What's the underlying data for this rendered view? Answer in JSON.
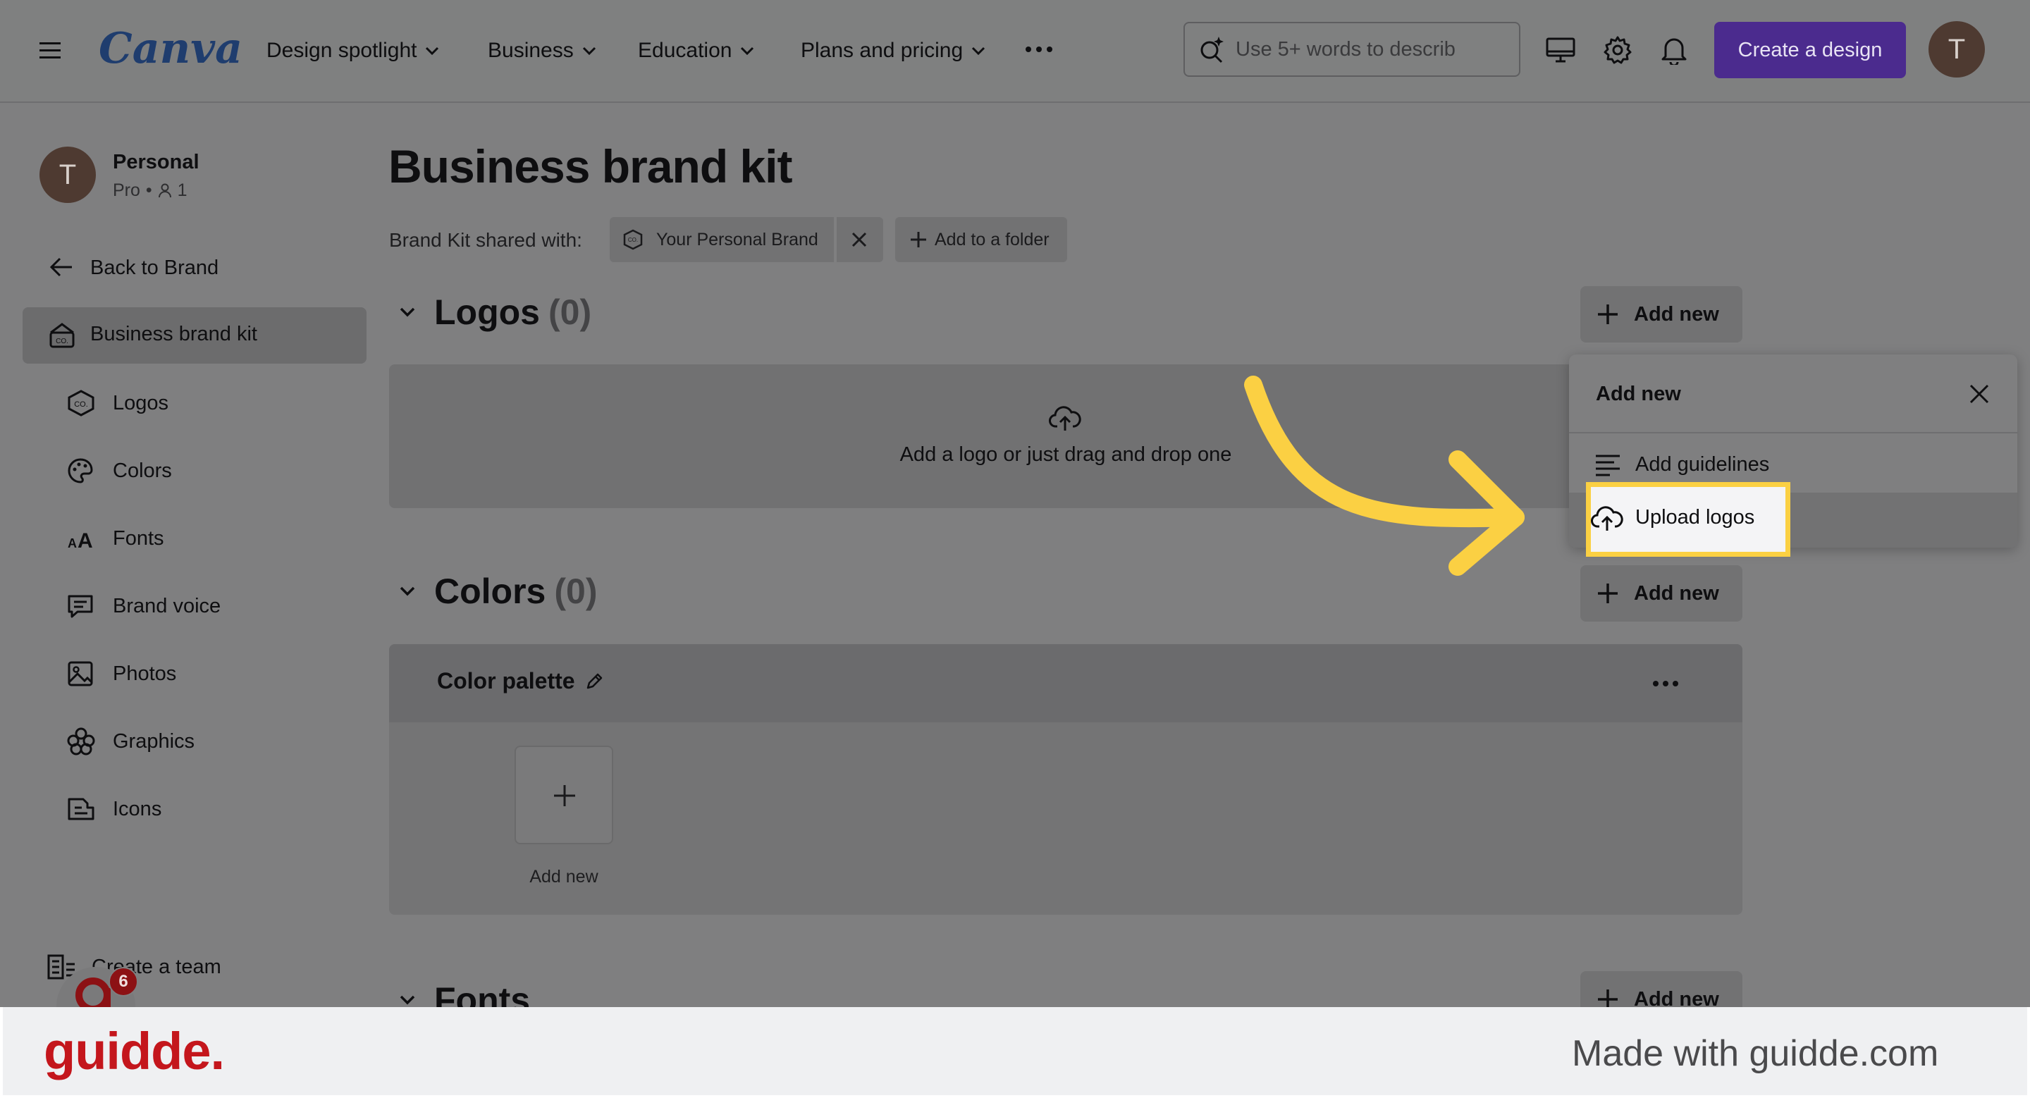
{
  "header": {
    "logo": "Canva",
    "nav": [
      {
        "label": "Design spotlight"
      },
      {
        "label": "Business"
      },
      {
        "label": "Education"
      },
      {
        "label": "Plans and pricing"
      }
    ],
    "search_placeholder": "Use 5+ words to describ",
    "create_label": "Create a design",
    "avatar_initial": "T"
  },
  "sidebar": {
    "account_name": "Personal",
    "account_plan": "Pro",
    "account_members": "1",
    "avatar_initial": "T",
    "back_label": "Back to Brand",
    "active_label": "Business brand kit",
    "items": [
      {
        "label": "Logos",
        "icon": "logo-icon"
      },
      {
        "label": "Colors",
        "icon": "palette-icon"
      },
      {
        "label": "Fonts",
        "icon": "font-icon"
      },
      {
        "label": "Brand voice",
        "icon": "brand-voice-icon"
      },
      {
        "label": "Photos",
        "icon": "photo-icon"
      },
      {
        "label": "Graphics",
        "icon": "graphics-icon"
      },
      {
        "label": "Icons",
        "icon": "icons-icon"
      }
    ],
    "create_team_label": "Create a team",
    "badge_count": "6"
  },
  "main": {
    "title": "Business brand kit",
    "shared_label": "Brand Kit shared with:",
    "shared_chip": "Your Personal Brand",
    "add_folder_label": "Add to a folder",
    "logos": {
      "heading": "Logos",
      "count": "(0)",
      "add_label": "Add new",
      "drop_text": "Add a logo or just drag and drop one"
    },
    "colors": {
      "heading": "Colors",
      "count": "(0)",
      "add_label": "Add new",
      "palette_title": "Color palette",
      "swatch_add_label": "Add new"
    },
    "fonts": {
      "heading": "Fonts",
      "add_label": "Add new"
    }
  },
  "dropdown": {
    "title": "Add new",
    "items": [
      {
        "label": "Add guidelines",
        "icon": "guidelines-icon"
      },
      {
        "label": "Upload logos",
        "icon": "upload-cloud-icon"
      }
    ]
  },
  "footer": {
    "brand": "guidde.",
    "tagline": "Made with guidde.com"
  },
  "colors": {
    "accent_purple": "#4b2b8e",
    "highlight_yellow": "#fbd043",
    "guidde_red": "#c4161c",
    "canva_blue": "#1f3d6e"
  }
}
